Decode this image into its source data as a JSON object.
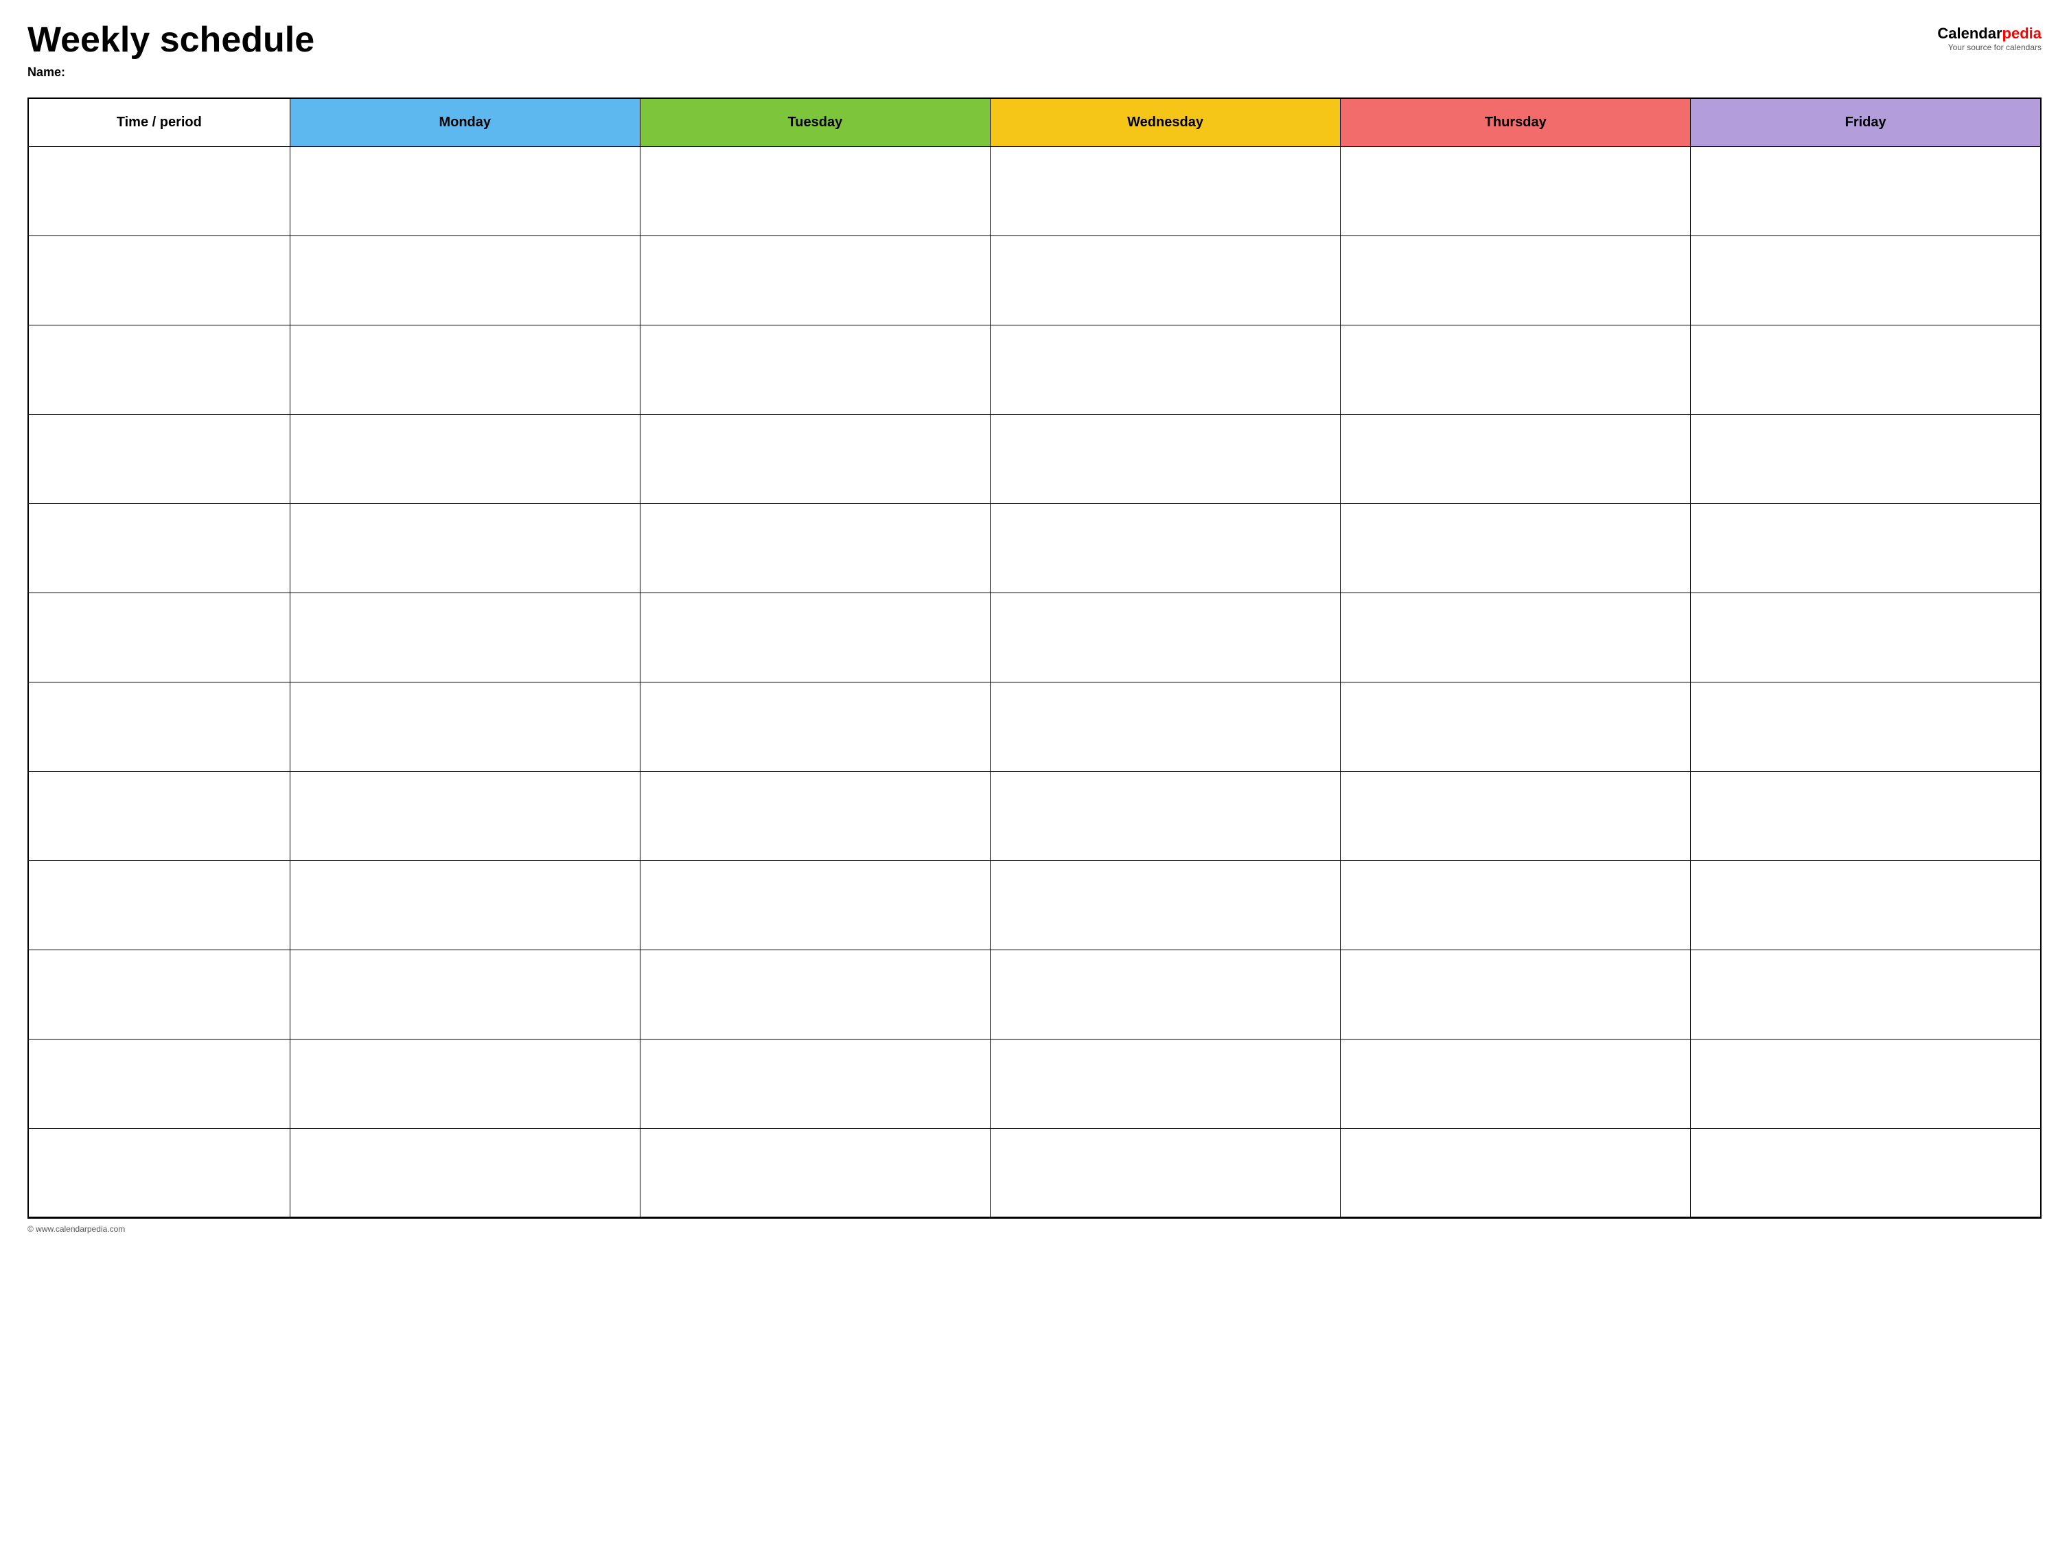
{
  "header": {
    "title": "Weekly schedule",
    "name_label": "Name:",
    "logo": {
      "calendar_part": "Calendar",
      "pedia_part": "pedia",
      "tagline": "Your source for calendars"
    }
  },
  "table": {
    "columns": [
      {
        "key": "time",
        "label": "Time / period",
        "color": "#ffffff"
      },
      {
        "key": "monday",
        "label": "Monday",
        "color": "#5db8f0"
      },
      {
        "key": "tuesday",
        "label": "Tuesday",
        "color": "#7dc63b"
      },
      {
        "key": "wednesday",
        "label": "Wednesday",
        "color": "#f5c518"
      },
      {
        "key": "thursday",
        "label": "Thursday",
        "color": "#f26c6c"
      },
      {
        "key": "friday",
        "label": "Friday",
        "color": "#b39ddb"
      }
    ],
    "row_count": 12
  },
  "footer": {
    "url": "© www.calendarpedia.com"
  }
}
